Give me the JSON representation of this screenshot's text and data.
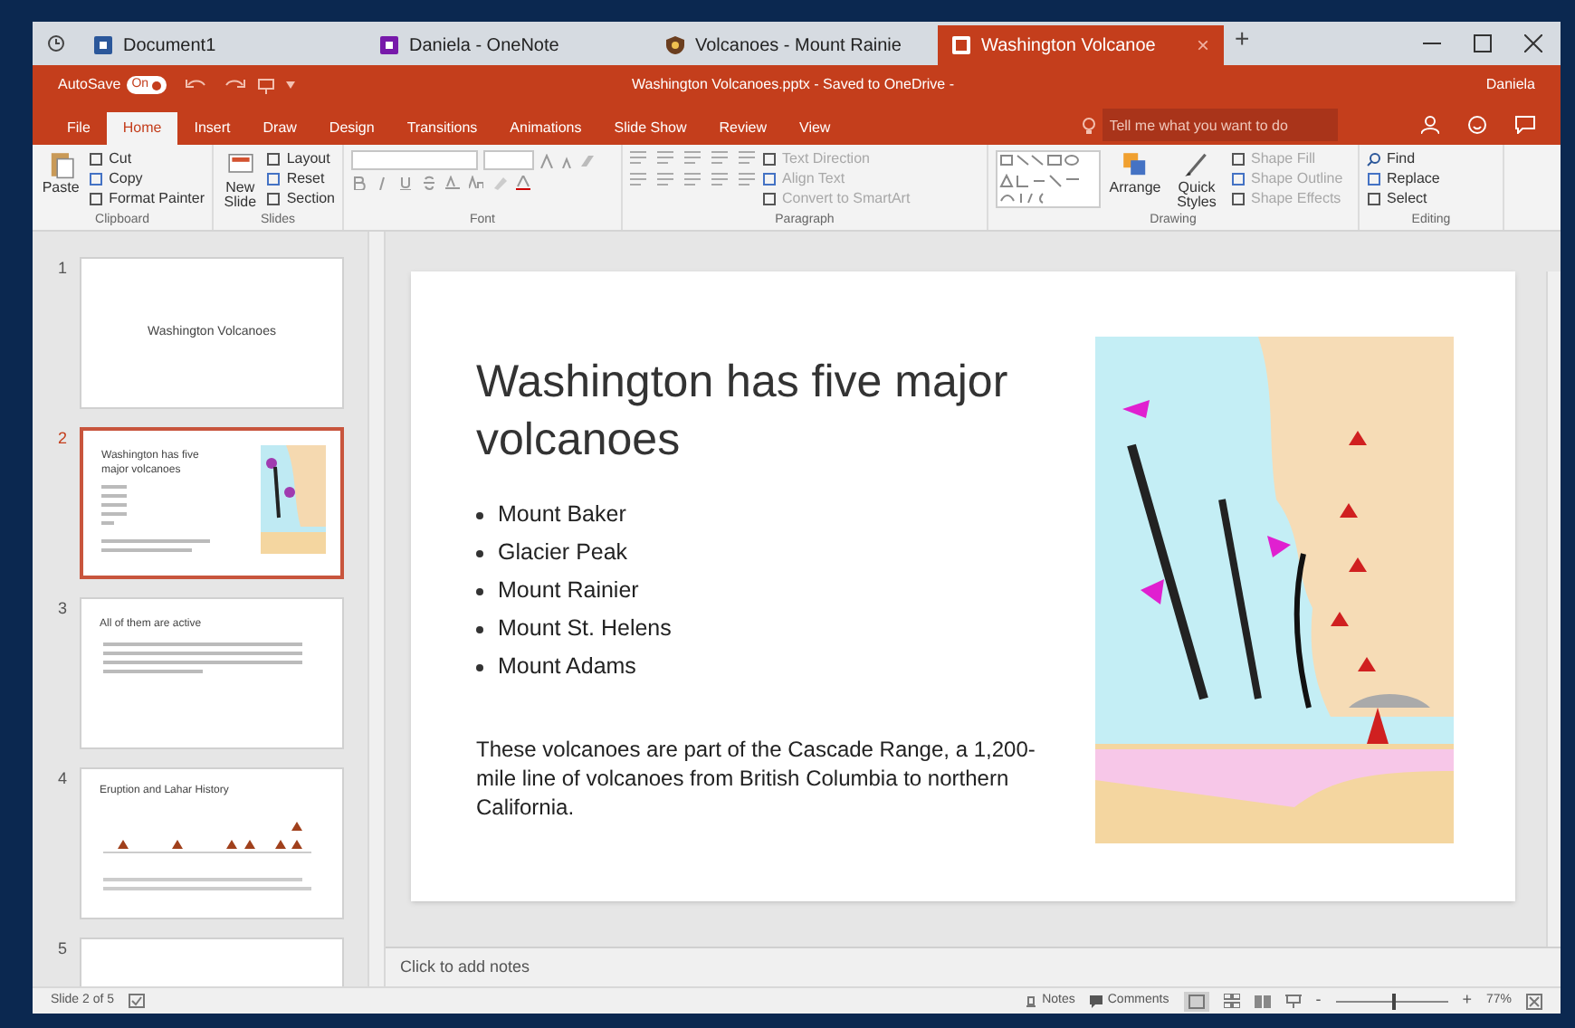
{
  "browser_tabs": [
    {
      "label": "Document1",
      "kind": "word",
      "selected": false
    },
    {
      "label": "Daniela - OneNote",
      "kind": "onenote",
      "selected": false
    },
    {
      "label": "Volcanoes - Mount Rainie",
      "kind": "web",
      "selected": false
    },
    {
      "label": "Washington Volcanoe",
      "kind": "ppt",
      "selected": true,
      "close": "×"
    }
  ],
  "new_tab": "+",
  "title_bar": {
    "autosave": "AutoSave",
    "toggle": "On",
    "autosave_on": true,
    "title": "Washington Volcanoes.pptx - Saved to OneDrive -",
    "user": "Daniela"
  },
  "ribbon_tabs": [
    {
      "label": "File",
      "selected": false
    },
    {
      "label": "Home",
      "selected": true
    },
    {
      "label": "Insert",
      "selected": false
    },
    {
      "label": "Draw",
      "selected": false
    },
    {
      "label": "Design",
      "selected": false
    },
    {
      "label": "Transitions",
      "selected": false
    },
    {
      "label": "Animations",
      "selected": false
    },
    {
      "label": "Slide Show",
      "selected": false
    },
    {
      "label": "Review",
      "selected": false
    },
    {
      "label": "View",
      "selected": false
    }
  ],
  "tell_me": {
    "placeholder": "Tell me what you want to do"
  },
  "ribbon_groups": [
    {
      "label": "Clipboard",
      "kind": "standard",
      "large": [
        "Paste"
      ],
      "small": [
        {
          "label": "Cut",
          "disabled": false
        },
        {
          "label": "Copy",
          "disabled": false
        },
        {
          "label": "Format Painter",
          "disabled": false
        }
      ]
    },
    {
      "label": "Slides",
      "kind": "standard",
      "large": [
        "New Slide"
      ],
      "small": [
        {
          "label": "Layout",
          "disabled": false
        },
        {
          "label": "Reset",
          "disabled": false
        },
        {
          "label": "Section",
          "disabled": false
        }
      ]
    },
    {
      "label": "Font",
      "kind": "font"
    },
    {
      "label": "Paragraph",
      "kind": "paragraph",
      "small": [
        {
          "label": "Text Direction",
          "disabled": true
        },
        {
          "label": "Align Text",
          "disabled": true
        },
        {
          "label": "Convert to SmartArt",
          "disabled": true
        }
      ]
    },
    {
      "label": "Drawing",
      "kind": "shapes",
      "large": [
        "Arrange",
        "Quick Styles"
      ],
      "small": [
        {
          "label": "Shape Fill",
          "disabled": true
        },
        {
          "label": "Shape Outline",
          "disabled": true
        },
        {
          "label": "Shape Effects",
          "disabled": true
        }
      ]
    },
    {
      "label": "Editing",
      "kind": "standard",
      "small": [
        {
          "label": "Find",
          "disabled": false
        },
        {
          "label": "Replace",
          "disabled": false
        },
        {
          "label": "Select",
          "disabled": false
        }
      ]
    }
  ],
  "thumbnails": [
    {
      "number": "1",
      "kind": "title",
      "title": "Washington Volcanoes",
      "selected": false
    },
    {
      "number": "2",
      "kind": "picture",
      "title": "Washington has five major volcanoes",
      "selected": true
    },
    {
      "number": "3",
      "kind": "bullets",
      "title": "All of them are active",
      "selected": false
    },
    {
      "number": "4",
      "kind": "chart",
      "title": "Eruption and Lahar History",
      "selected": false
    },
    {
      "number": "5",
      "kind": "blank",
      "selected": false
    }
  ],
  "slide": {
    "title": "Washington has five major volcanoes",
    "bullets": [
      "Mount Baker",
      "Glacier Peak",
      "Mount Rainier",
      "Mount St. Helens",
      "Mount Adams"
    ],
    "paragraph": "These volcanoes are part of the Cascade Range, a 1,200-mile line of volcanoes from British Columbia to northern California.",
    "image": {
      "kind": "picture"
    }
  },
  "notes": {
    "placeholder": "Click to add notes"
  },
  "status_bar": {
    "slide": "Slide 2 of 5",
    "notes": "Notes",
    "comments": "Comments",
    "zoom_out": "-",
    "zoom_in": "+",
    "zoom": "77%",
    "level": 0.5
  }
}
